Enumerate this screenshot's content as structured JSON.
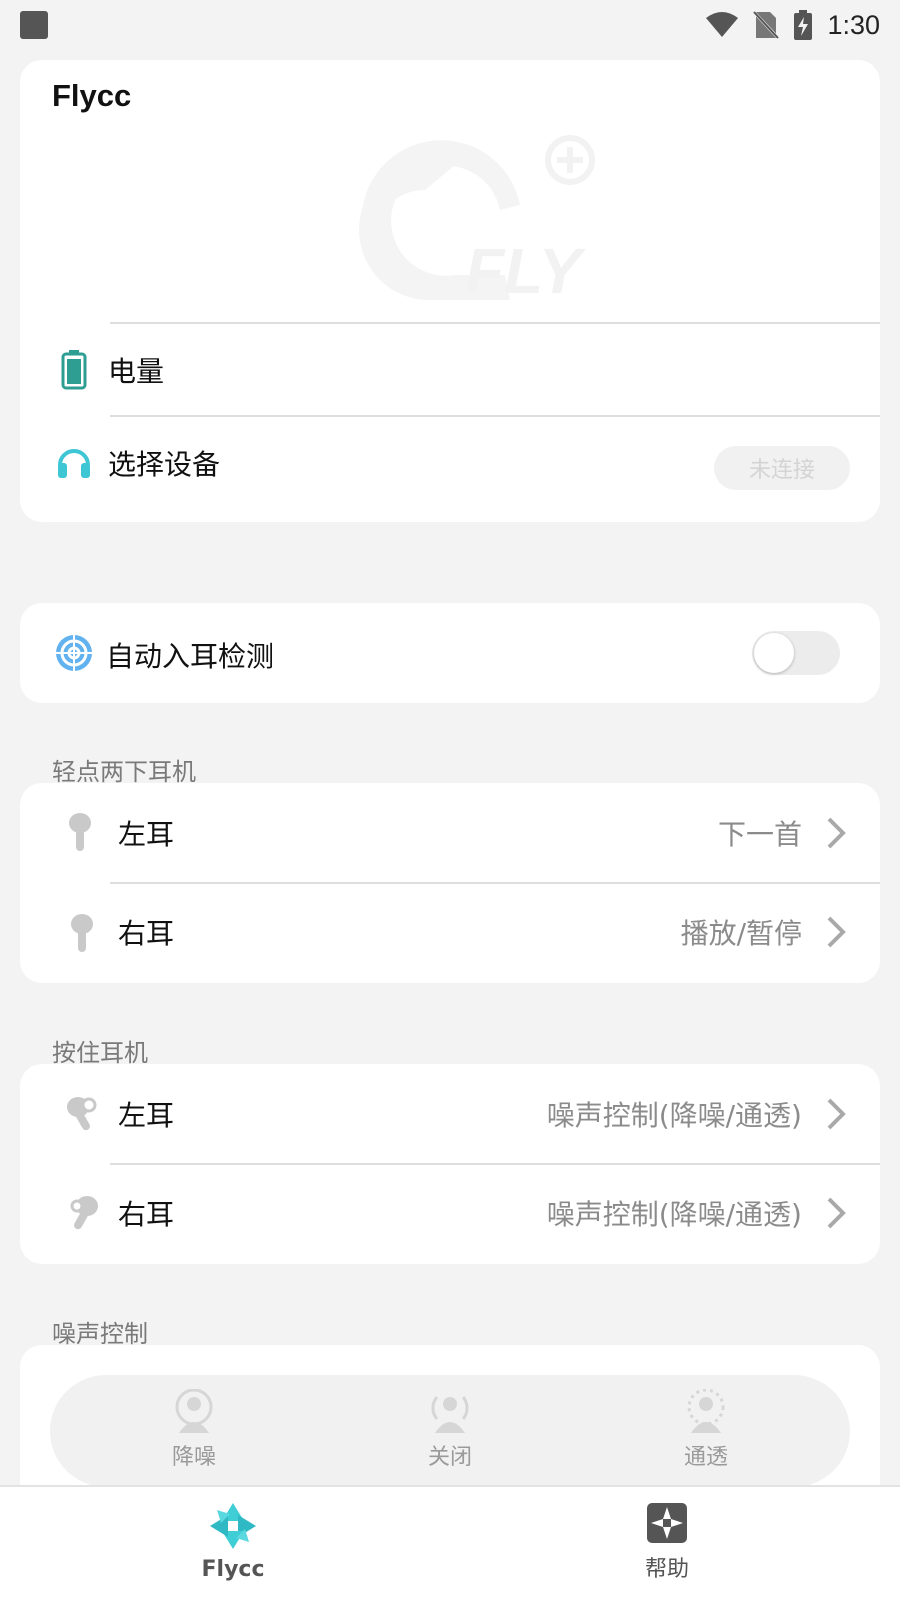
{
  "status_bar": {
    "time": "1:30"
  },
  "app": {
    "title": "Flycc"
  },
  "header_card": {
    "battery_label": "电量",
    "device_label": "选择设备",
    "device_status": "未连接"
  },
  "auto_ear": {
    "label": "自动入耳检测",
    "enabled": false
  },
  "double_tap": {
    "section_title": "轻点两下耳机",
    "left": {
      "label": "左耳",
      "value": "下一首"
    },
    "right": {
      "label": "右耳",
      "value": "播放/暂停"
    }
  },
  "long_press": {
    "section_title": "按住耳机",
    "left": {
      "label": "左耳",
      "value": "噪声控制(降噪/通透)"
    },
    "right": {
      "label": "右耳",
      "value": "噪声控制(降噪/通透)"
    }
  },
  "noise_control": {
    "section_title": "噪声控制",
    "options": [
      {
        "label": "降噪"
      },
      {
        "label": "关闭"
      },
      {
        "label": "通透"
      }
    ]
  },
  "bottom_nav": {
    "items": [
      {
        "label": "Flycc",
        "active": true
      },
      {
        "label": "帮助",
        "active": false
      }
    ]
  },
  "colors": {
    "accent": "#3fcdd6",
    "battery": "#2e9e93",
    "headphone": "#3fc6d4",
    "target": "#62b2f0",
    "background": "#f3f3f3"
  }
}
